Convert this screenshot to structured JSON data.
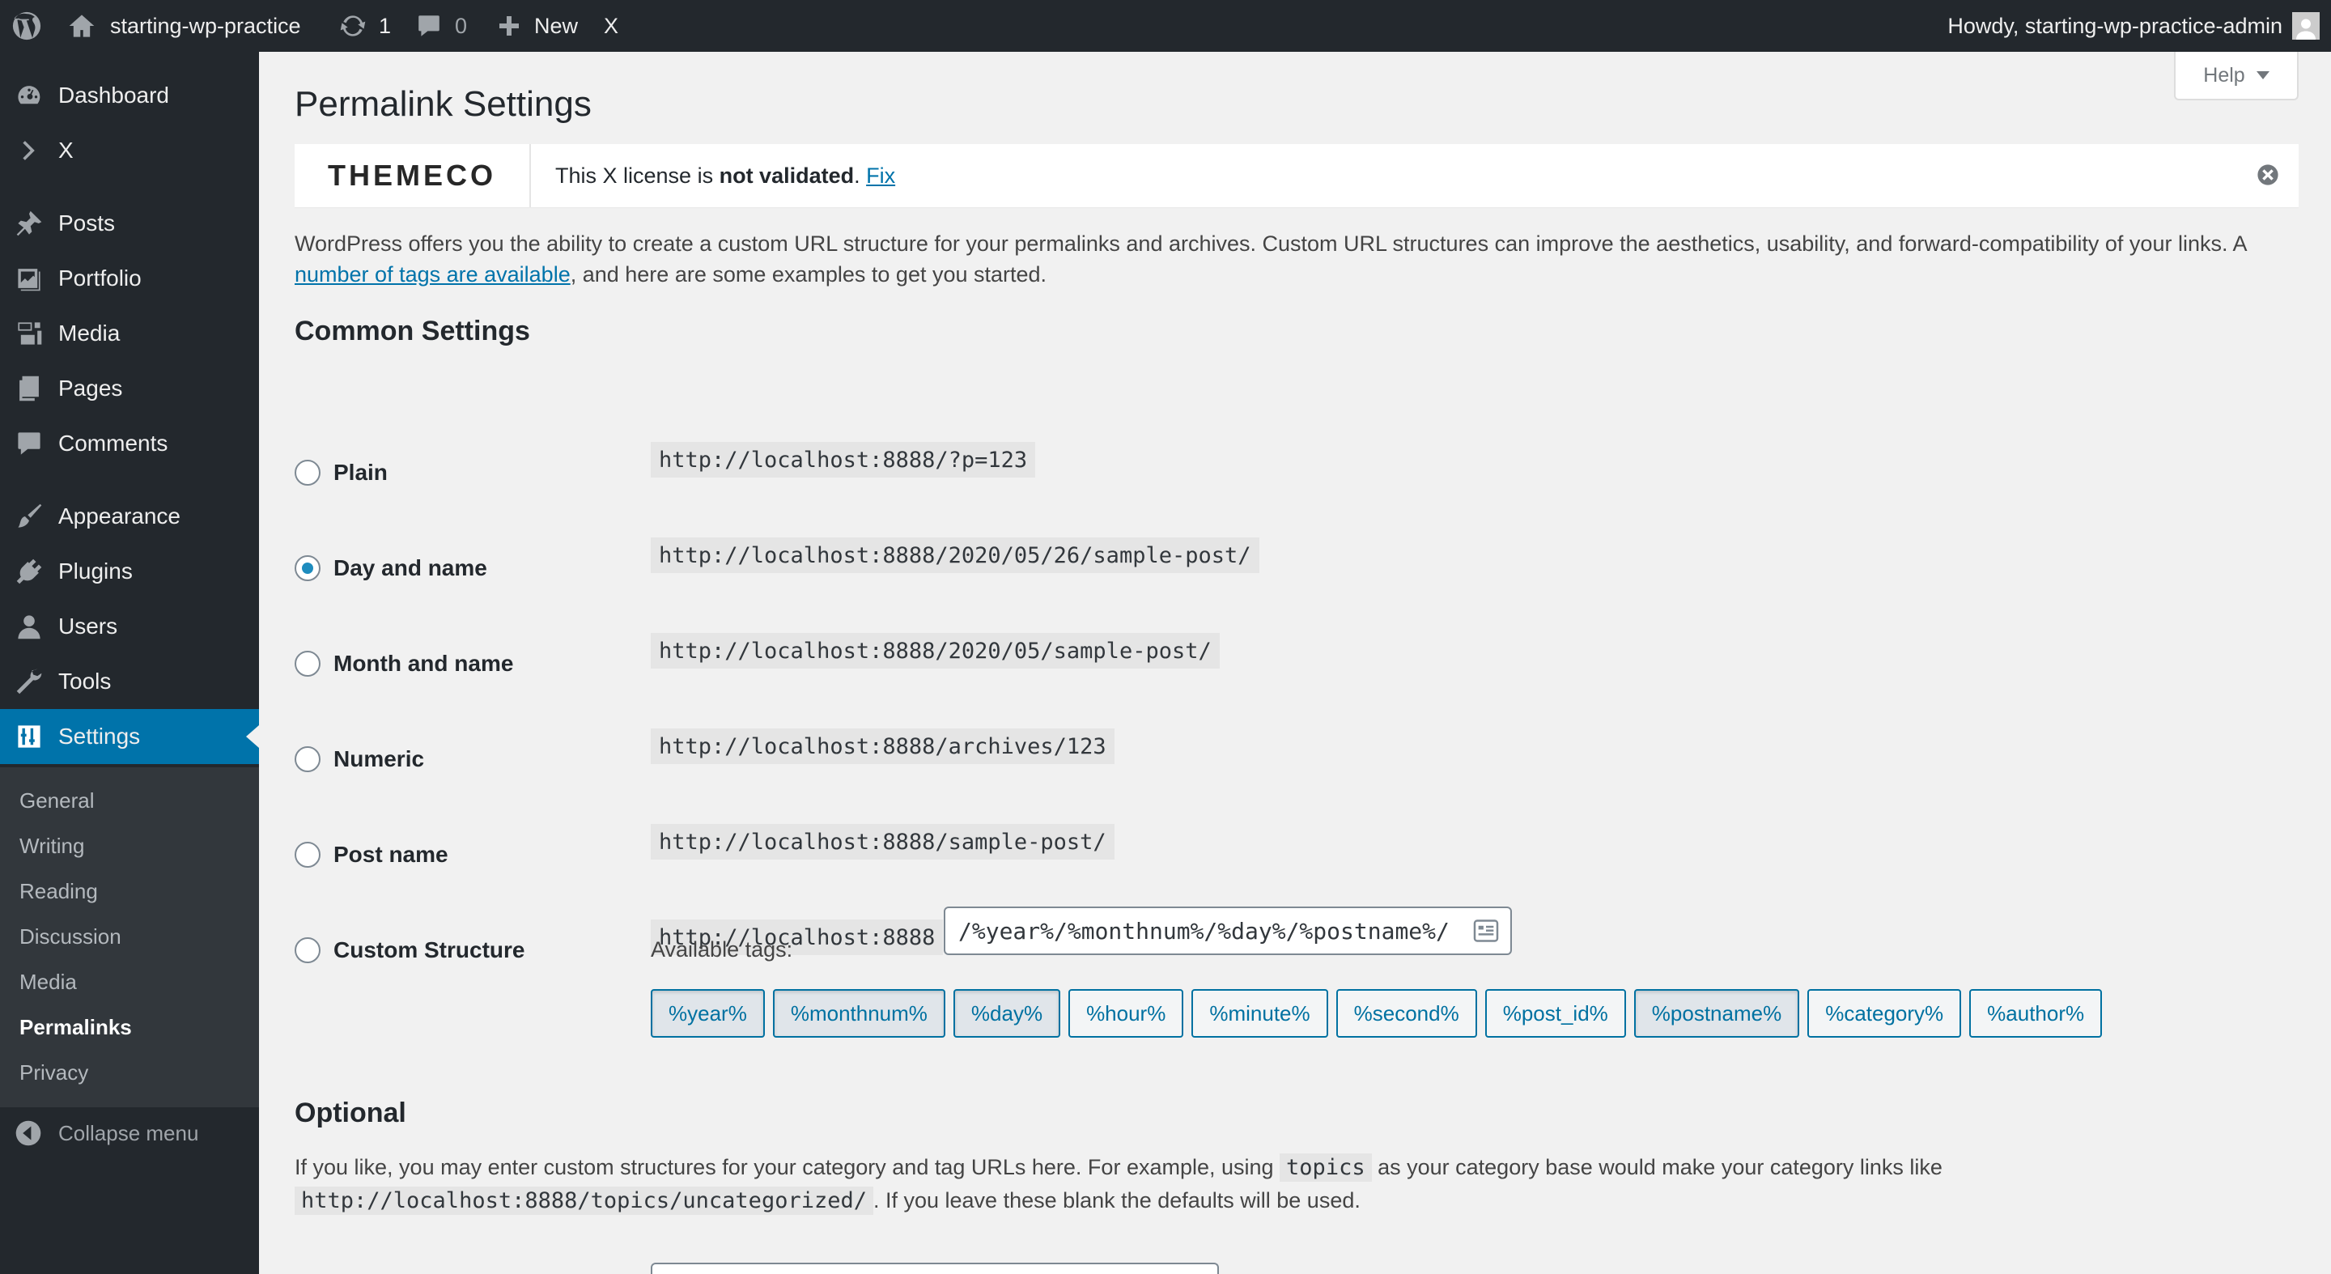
{
  "adminbar": {
    "site_name": "starting-wp-practice",
    "updates_count": "1",
    "comments_count": "0",
    "new_label": "New",
    "x_label": "X",
    "greeting": "Howdy, starting-wp-practice-admin"
  },
  "sidebar": {
    "items": [
      {
        "label": "Dashboard",
        "icon": "dashboard-icon"
      },
      {
        "label": "X",
        "icon": "chevron-right-icon"
      },
      {
        "label": "Posts",
        "icon": "pin-icon"
      },
      {
        "label": "Portfolio",
        "icon": "portfolio-icon"
      },
      {
        "label": "Media",
        "icon": "media-icon"
      },
      {
        "label": "Pages",
        "icon": "pages-icon"
      },
      {
        "label": "Comments",
        "icon": "comments-icon"
      },
      {
        "label": "Appearance",
        "icon": "brush-icon"
      },
      {
        "label": "Plugins",
        "icon": "plugin-icon"
      },
      {
        "label": "Users",
        "icon": "user-icon"
      },
      {
        "label": "Tools",
        "icon": "wrench-icon"
      },
      {
        "label": "Settings",
        "icon": "settings-icon"
      }
    ],
    "submenu": [
      "General",
      "Writing",
      "Reading",
      "Discussion",
      "Media",
      "Permalinks",
      "Privacy"
    ],
    "active_submenu": "Permalinks",
    "collapse_label": "Collapse menu"
  },
  "help_label": "Help",
  "page_title": "Permalink Settings",
  "notice": {
    "logo": "THEMECO",
    "prefix": "This X license is ",
    "bold": "not validated",
    "suffix": ".",
    "link": "Fix"
  },
  "intro": {
    "text1": "WordPress offers you the ability to create a custom URL structure for your permalinks and archives. Custom URL structures can improve the aesthetics, usability, and forward-compatibility of your links. A ",
    "link": "number of tags are available",
    "text2": ", and here are some examples to get you started."
  },
  "common_settings_title": "Common Settings",
  "options": [
    {
      "label": "Plain",
      "example": "http://localhost:8888/?p=123",
      "checked": false
    },
    {
      "label": "Day and name",
      "example": "http://localhost:8888/2020/05/26/sample-post/",
      "checked": true
    },
    {
      "label": "Month and name",
      "example": "http://localhost:8888/2020/05/sample-post/",
      "checked": false
    },
    {
      "label": "Numeric",
      "example": "http://localhost:8888/archives/123",
      "checked": false
    },
    {
      "label": "Post name",
      "example": "http://localhost:8888/sample-post/",
      "checked": false
    },
    {
      "label": "Custom Structure",
      "example": "http://localhost:8888",
      "checked": false
    }
  ],
  "custom_structure_value": "/%year%/%monthnum%/%day%/%postname%/",
  "available_tags_label": "Available tags:",
  "tags": [
    {
      "label": "%year%",
      "active": true
    },
    {
      "label": "%monthnum%",
      "active": true
    },
    {
      "label": "%day%",
      "active": true
    },
    {
      "label": "%hour%",
      "active": false
    },
    {
      "label": "%minute%",
      "active": false
    },
    {
      "label": "%second%",
      "active": false
    },
    {
      "label": "%post_id%",
      "active": false
    },
    {
      "label": "%postname%",
      "active": true
    },
    {
      "label": "%category%",
      "active": false
    },
    {
      "label": "%author%",
      "active": false
    }
  ],
  "optional_title": "Optional",
  "optional": {
    "text1": "If you like, you may enter custom structures for your category and tag URLs here. For example, using ",
    "code1": "topics",
    "text2": " as your category base would make your category links like",
    "code2": "http://localhost:8888/topics/uncategorized/",
    "text3": ". If you leave these blank the defaults will be used."
  },
  "colors": {
    "admin_bar": "#23282d",
    "accent": "#0073aa",
    "submenu_bg": "#32373c"
  }
}
